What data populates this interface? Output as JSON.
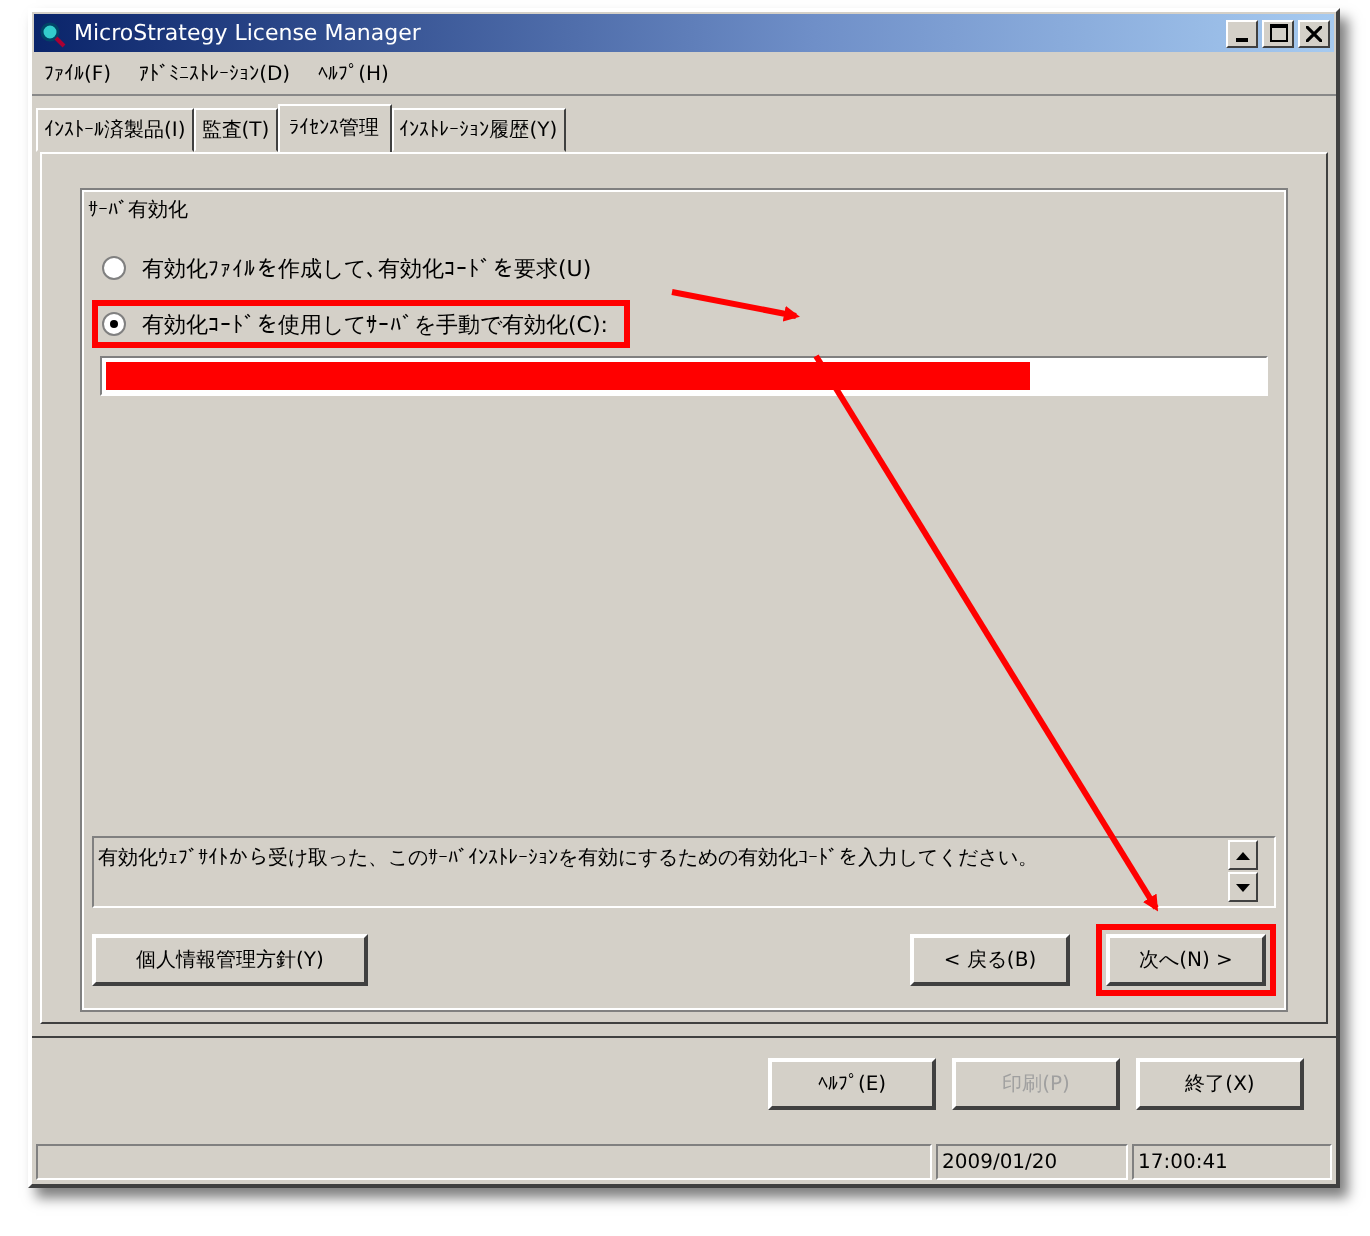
{
  "window": {
    "title": "MicroStrategy License Manager"
  },
  "menu": [
    {
      "label": "ﾌｧｲﾙ(F)"
    },
    {
      "label": "ｱﾄﾞﾐﾆｽﾄﾚｰｼｮﾝ(D)"
    },
    {
      "label": "ﾍﾙﾌﾟ(H)"
    }
  ],
  "tabs": [
    {
      "label": "ｲﾝｽﾄｰﾙ済製品(I)",
      "selected": false
    },
    {
      "label": "監査(T)",
      "selected": false
    },
    {
      "label": "ﾗｲｾﾝｽ管理",
      "selected": true
    },
    {
      "label": "ｲﾝｽﾄﾚｰｼｮﾝ履歴(Y)",
      "selected": false
    }
  ],
  "group": {
    "title": "ｻｰﾊﾞ有効化",
    "options": [
      {
        "label": "有効化ﾌｧｲﾙを作成して､有効化ｺｰﾄﾞを要求(U)",
        "selected": false,
        "highlighted": false
      },
      {
        "label": "有効化ｺｰﾄﾞを使用してｻｰﾊﾞを手動で有効化(C):",
        "selected": true,
        "highlighted": true
      }
    ],
    "code_field": {
      "redacted": true
    },
    "description": "有効化ｳｪﾌﾞｻｲﾄから受け取った、このｻｰﾊﾞｲﾝｽﾄﾚｰｼｮﾝを有効にするための有効化ｺｰﾄﾞを入力してください。",
    "privacy_button": "個人情報管理方針(Y)",
    "nav_buttons": [
      {
        "label": "< 戻る(B)",
        "highlighted": false
      },
      {
        "label": "次へ(N) >",
        "highlighted": true
      }
    ]
  },
  "buttons": [
    {
      "label": "ﾍﾙﾌﾟ(E)",
      "disabled": false
    },
    {
      "label": "印刷(P)",
      "disabled": true
    },
    {
      "label": "終了(X)",
      "disabled": false
    }
  ],
  "status_bar": [
    "2009/01/20",
    "17:00:41"
  ]
}
